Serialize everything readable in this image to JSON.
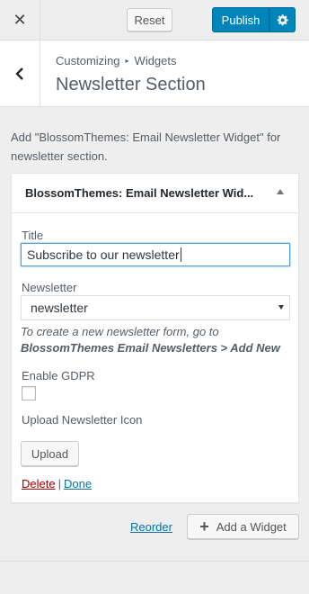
{
  "header": {
    "close_icon": "close-icon",
    "reset_label": "Reset",
    "publish_label": "Publish",
    "settings_icon": "gear-icon",
    "publish_color": "#0085ba"
  },
  "section": {
    "back_icon": "chevron-left-icon",
    "breadcrumb": [
      "Customizing",
      "Widgets"
    ],
    "title": "Newsletter Section"
  },
  "description": "Add \"BlossomThemes: Email Newsletter Widget\" for newsletter section.",
  "widget": {
    "name": "BlossomThemes: Email Newsletter Wid...",
    "expanded": true,
    "title_label": "Title",
    "title_value": "Subscribe to our newsletter",
    "newsletter_label": "Newsletter",
    "newsletter_selected": "newsletter",
    "hint_prefix": "To create a new newsletter form, go to",
    "hint_path": "BlossomThemes Email Newsletters > Add New",
    "gdpr_label": "Enable GDPR",
    "gdpr_checked": false,
    "icon_label": "Upload Newsletter Icon",
    "upload_label": "Upload",
    "delete_label": "Delete",
    "separator": "|",
    "done_label": "Done"
  },
  "footer": {
    "reorder_label": "Reorder",
    "add_widget_label": "Add a Widget",
    "add_icon": "plus-icon"
  }
}
